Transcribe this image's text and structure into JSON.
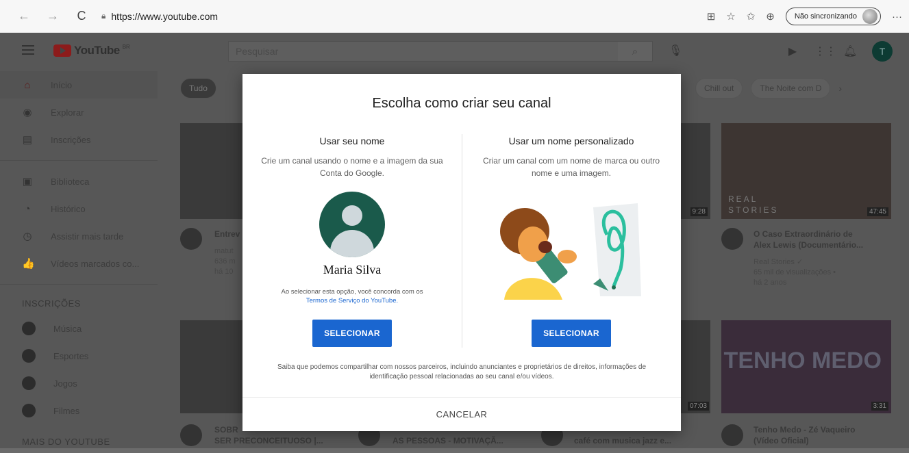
{
  "browser": {
    "back": "←",
    "forward": "→",
    "reload": "C",
    "url": "https://www.youtube.com",
    "sync_label": "Não sincronizando",
    "more": "···"
  },
  "youtube": {
    "logo_text": "YouTube",
    "logo_sup": "BR",
    "search_placeholder": "Pesquisar",
    "user_initial": "T",
    "sidebar": {
      "items": [
        {
          "label": "Início",
          "icon": "⌂"
        },
        {
          "label": "Explorar",
          "icon": "◉"
        },
        {
          "label": "Inscrições",
          "icon": "▤"
        },
        {
          "label": "Biblioteca",
          "icon": "▣"
        },
        {
          "label": "Histórico",
          "icon": "◔"
        },
        {
          "label": "Assistir mais tarde",
          "icon": "◷"
        },
        {
          "label": "Vídeos marcados co...",
          "icon": "👍"
        }
      ],
      "subs_header": "INSCRIÇÕES",
      "subs": [
        {
          "label": "Música"
        },
        {
          "label": "Esportes"
        },
        {
          "label": "Jogos"
        },
        {
          "label": "Filmes"
        }
      ],
      "more_header": "MAIS DO YOUTUBE"
    },
    "chips_left": [
      "Tudo"
    ],
    "chips_right": [
      "Chill out",
      "The Noite com D"
    ],
    "videos": [
      {
        "title": "Entrev",
        "meta1": "matut",
        "meta2": "636 m",
        "meta3": "há 10"
      },
      {
        "title": "O Caso Extraordinário de",
        "title2": "Alex Lewis (Documentário...",
        "meta1": "Real Stories ✓",
        "meta2": "65 mil de visualizações •",
        "meta3": "há 2 anos",
        "duration": "47:45",
        "thumb_text1": "REAL",
        "thumb_text2": "STORIES"
      },
      {
        "title": "Tenho Medo - Zé Vaqueiro",
        "title2": "(Vídeo Oficial)",
        "duration": "3:31",
        "thumb_text": "TENHO MEDO"
      },
      {
        "title": "SOBR",
        "title2": "SER PRECONCEITUOSO |..."
      },
      {
        "title2": "AS PESSOAS - MOTIVAÇÃ..."
      },
      {
        "title2": "café com musica jazz e..."
      }
    ],
    "durations_mid": [
      "9:28",
      "07:03"
    ]
  },
  "dialog": {
    "title": "Escolha como criar seu canal",
    "left": {
      "title": "Usar seu nome",
      "desc": "Crie um canal usando o nome e a imagem da sua Conta do Google.",
      "name": "Maria Silva",
      "terms_text": "Ao selecionar esta opção, você concorda com os",
      "terms_link": "Termos de Serviço do YouTube.",
      "button": "SELECIONAR"
    },
    "right": {
      "title": "Usar um nome personalizado",
      "desc": "Criar um canal com um nome de marca ou outro nome e uma imagem.",
      "button": "SELECIONAR"
    },
    "footnote": "Saiba que podemos compartilhar com nossos parceiros, incluindo anunciantes e proprietários de direitos, informações de identificação pessoal relacionadas ao seu canal e/ou vídeos.",
    "cancel": "CANCELAR"
  }
}
